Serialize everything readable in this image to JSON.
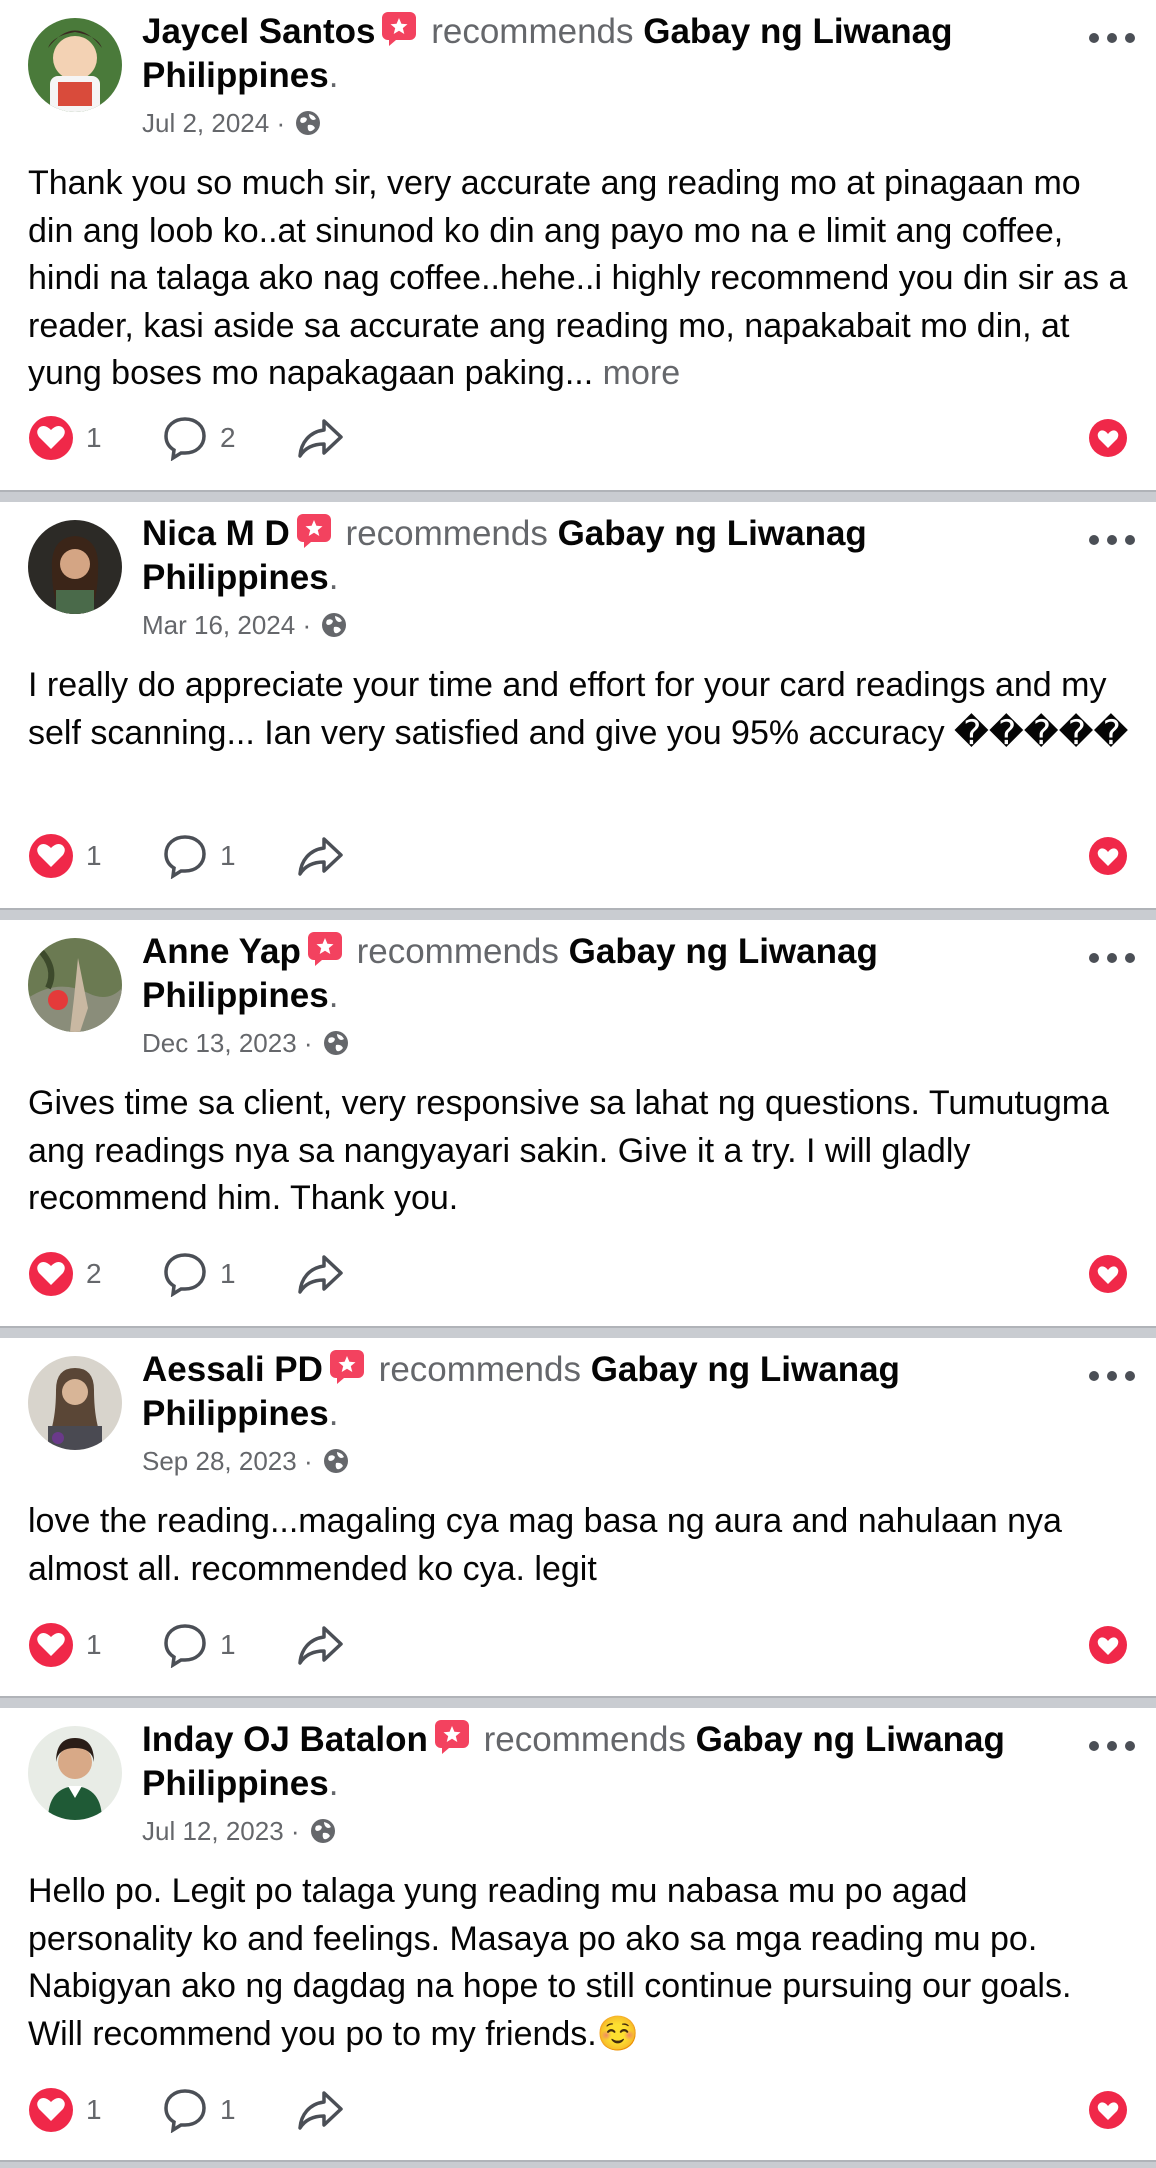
{
  "colors": {
    "heart": "#f02849",
    "text": "#050505",
    "secondary": "#65676b",
    "divider": "#c9ccd1"
  },
  "posts": [
    {
      "author": "Jaycel Santos",
      "recommends": "recommends",
      "page": "Gabay ng Liwanag",
      "page_line2": "Philippines",
      "period": ".",
      "date": "Jul 2, 2024",
      "meta_sep": "·",
      "text": "Thank you so much sir, very accurate ang reading mo at pinagaan mo din ang loob ko..at sinunod ko din ang payo mo na e limit ang coffee, hindi na talaga ako nag coffee..hehe..i highly recommend you din sir as a reader, kasi aside sa accurate ang reading mo, napakabait mo din, at yung boses mo napakagaan paking...",
      "more": "more",
      "reactions": "1",
      "comments": "2",
      "icons": {
        "recommend": "recommend-badge-icon",
        "privacy": "globe-icon",
        "reaction": "heart-icon"
      }
    },
    {
      "author": "Nica M D",
      "recommends": "recommends",
      "page": "Gabay ng Liwanag",
      "page_line2": "Philippines",
      "period": ".",
      "date": "Mar 16, 2024",
      "meta_sep": "·",
      "text": "I really do appreciate your time and effort for your card readings and my self scanning... Ian very satisfied and give you 95% accuracy �����",
      "more": "",
      "reactions": "1",
      "comments": "1",
      "icons": {
        "recommend": "recommend-badge-icon",
        "privacy": "globe-icon",
        "reaction": "heart-icon"
      }
    },
    {
      "author": "Anne Yap",
      "recommends": "recommends",
      "page": "Gabay ng Liwanag",
      "page_line2": "Philippines",
      "period": ".",
      "date": "Dec 13, 2023",
      "meta_sep": "·",
      "text": "Gives time sa client, very responsive sa lahat ng questions. Tumutugma ang readings nya sa nangyayari sakin. Give it a try. I will gladly recommend him. Thank you.",
      "more": "",
      "reactions": "2",
      "comments": "1",
      "icons": {
        "recommend": "recommend-badge-icon",
        "privacy": "globe-icon",
        "reaction": "heart-icon"
      }
    },
    {
      "author": "Aessali PD",
      "recommends": "recommends",
      "page": "Gabay ng Liwanag",
      "page_line2": "Philippines",
      "period": ".",
      "date": "Sep 28, 2023",
      "meta_sep": "·",
      "text": "love the reading...magaling cya mag basa ng aura and nahulaan nya almost all. recommended ko cya. legit",
      "more": "",
      "reactions": "1",
      "comments": "1",
      "icons": {
        "recommend": "recommend-badge-icon",
        "privacy": "globe-icon",
        "reaction": "heart-icon"
      }
    },
    {
      "author": "Inday OJ Batalon",
      "recommends": "recommends",
      "page": "Gabay ng Liwanag",
      "page_line2": "Philippines",
      "period": ".",
      "date": "Jul 12, 2023",
      "meta_sep": "·",
      "text": "Hello po. Legit po talaga yung reading mu nabasa mu po agad personality ko and feelings. Masaya po ako sa mga reading mu po. Nabigyan ako ng dagdag na hope to still continue pursuing our goals. Will recommend you po to my friends.☺️",
      "more": "",
      "reactions": "1",
      "comments": "1",
      "icons": {
        "recommend": "recommend-badge-icon",
        "privacy": "globe-icon",
        "reaction": "heart-icon"
      }
    }
  ]
}
